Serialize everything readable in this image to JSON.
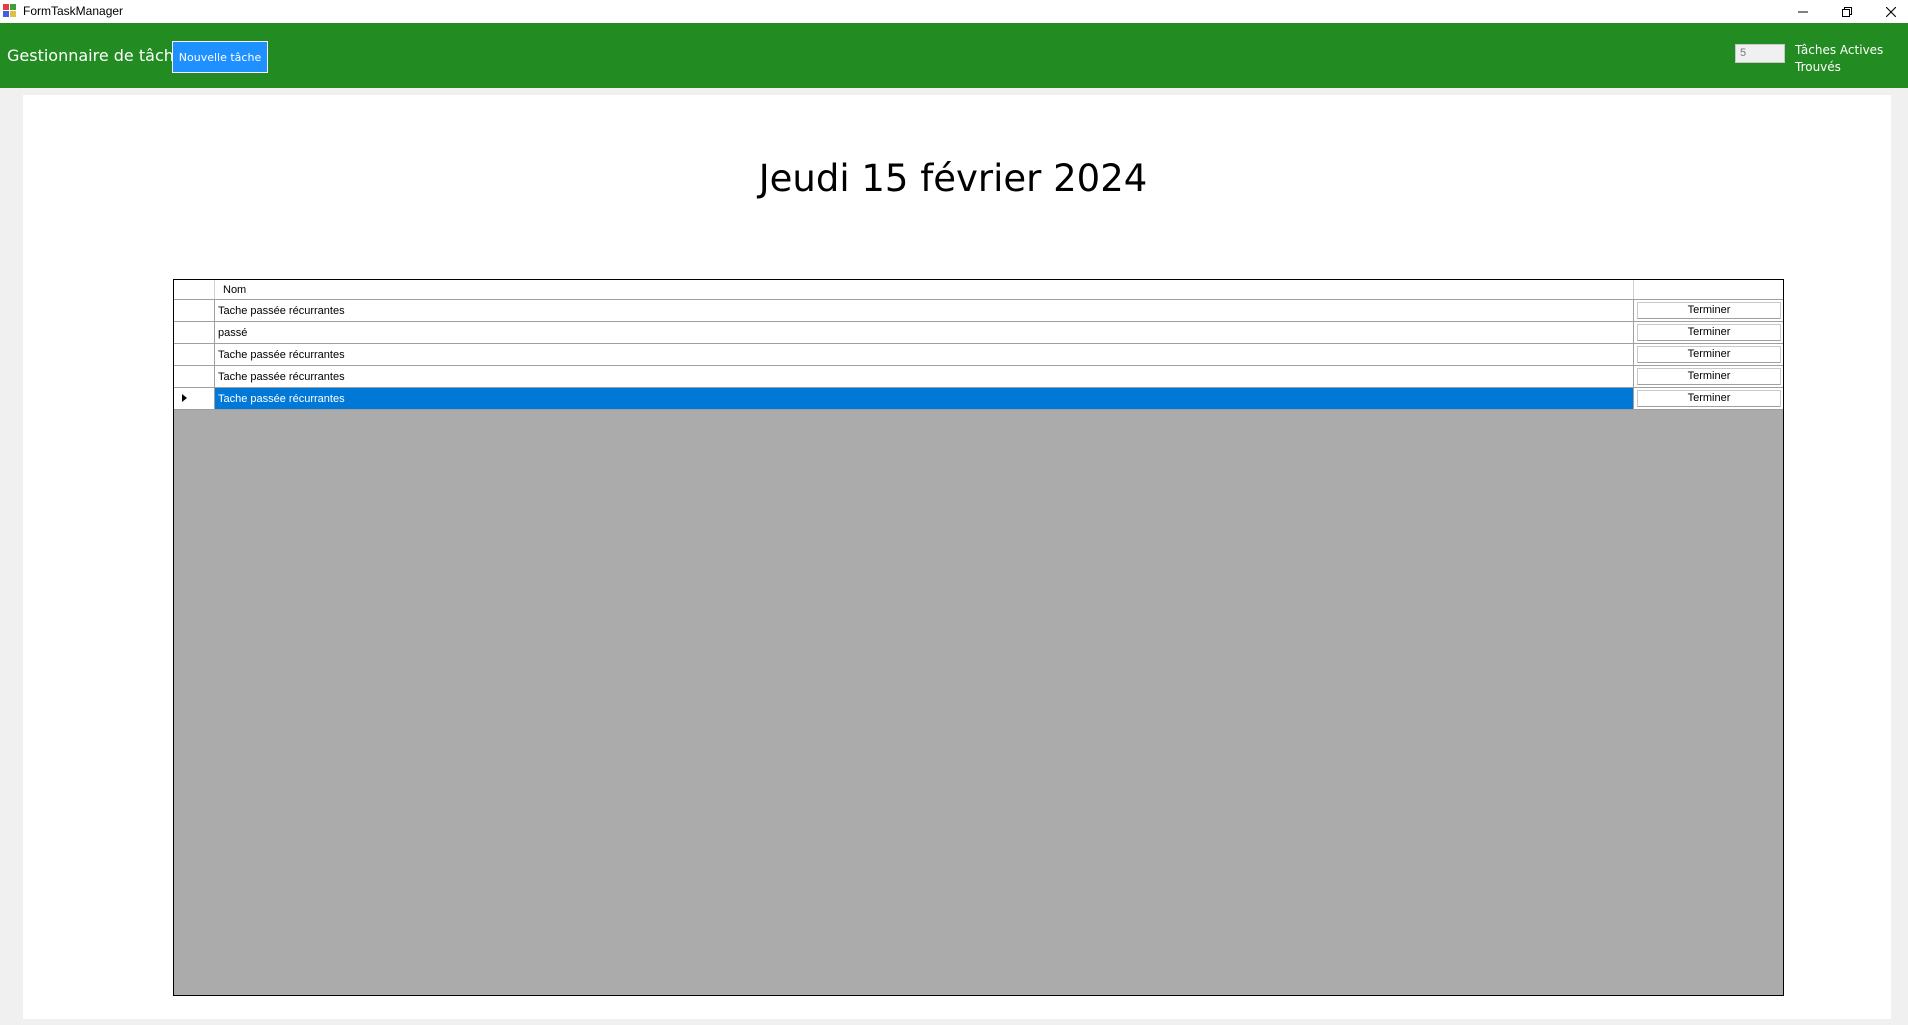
{
  "window": {
    "title": "FormTaskManager",
    "app_icon": "winforms-app-icon",
    "controls": [
      "minimize-icon",
      "restore-icon",
      "close-icon"
    ]
  },
  "header": {
    "app_title": "Gestionnaire de tâches",
    "new_task_label": "Nouvelle tâche",
    "active_count": "5",
    "active_label": "Tâches Actives\nTrouvés",
    "background_color": "#228b22",
    "button_color": "#1e90ff"
  },
  "main": {
    "date_title": "Jeudi 15 février 2024"
  },
  "grid": {
    "columns": [
      "Nom",
      ""
    ],
    "rows": [
      {
        "name": "Tache passée récurrantes",
        "action": "Terminer",
        "selected": false
      },
      {
        "name": "passé",
        "action": "Terminer",
        "selected": false
      },
      {
        "name": "Tache passée récurrantes",
        "action": "Terminer",
        "selected": false
      },
      {
        "name": "Tache passée récurrantes",
        "action": "Terminer",
        "selected": false
      },
      {
        "name": "Tache passée récurrantes",
        "action": "Terminer",
        "selected": true
      }
    ],
    "selection_color": "#0078d7"
  }
}
